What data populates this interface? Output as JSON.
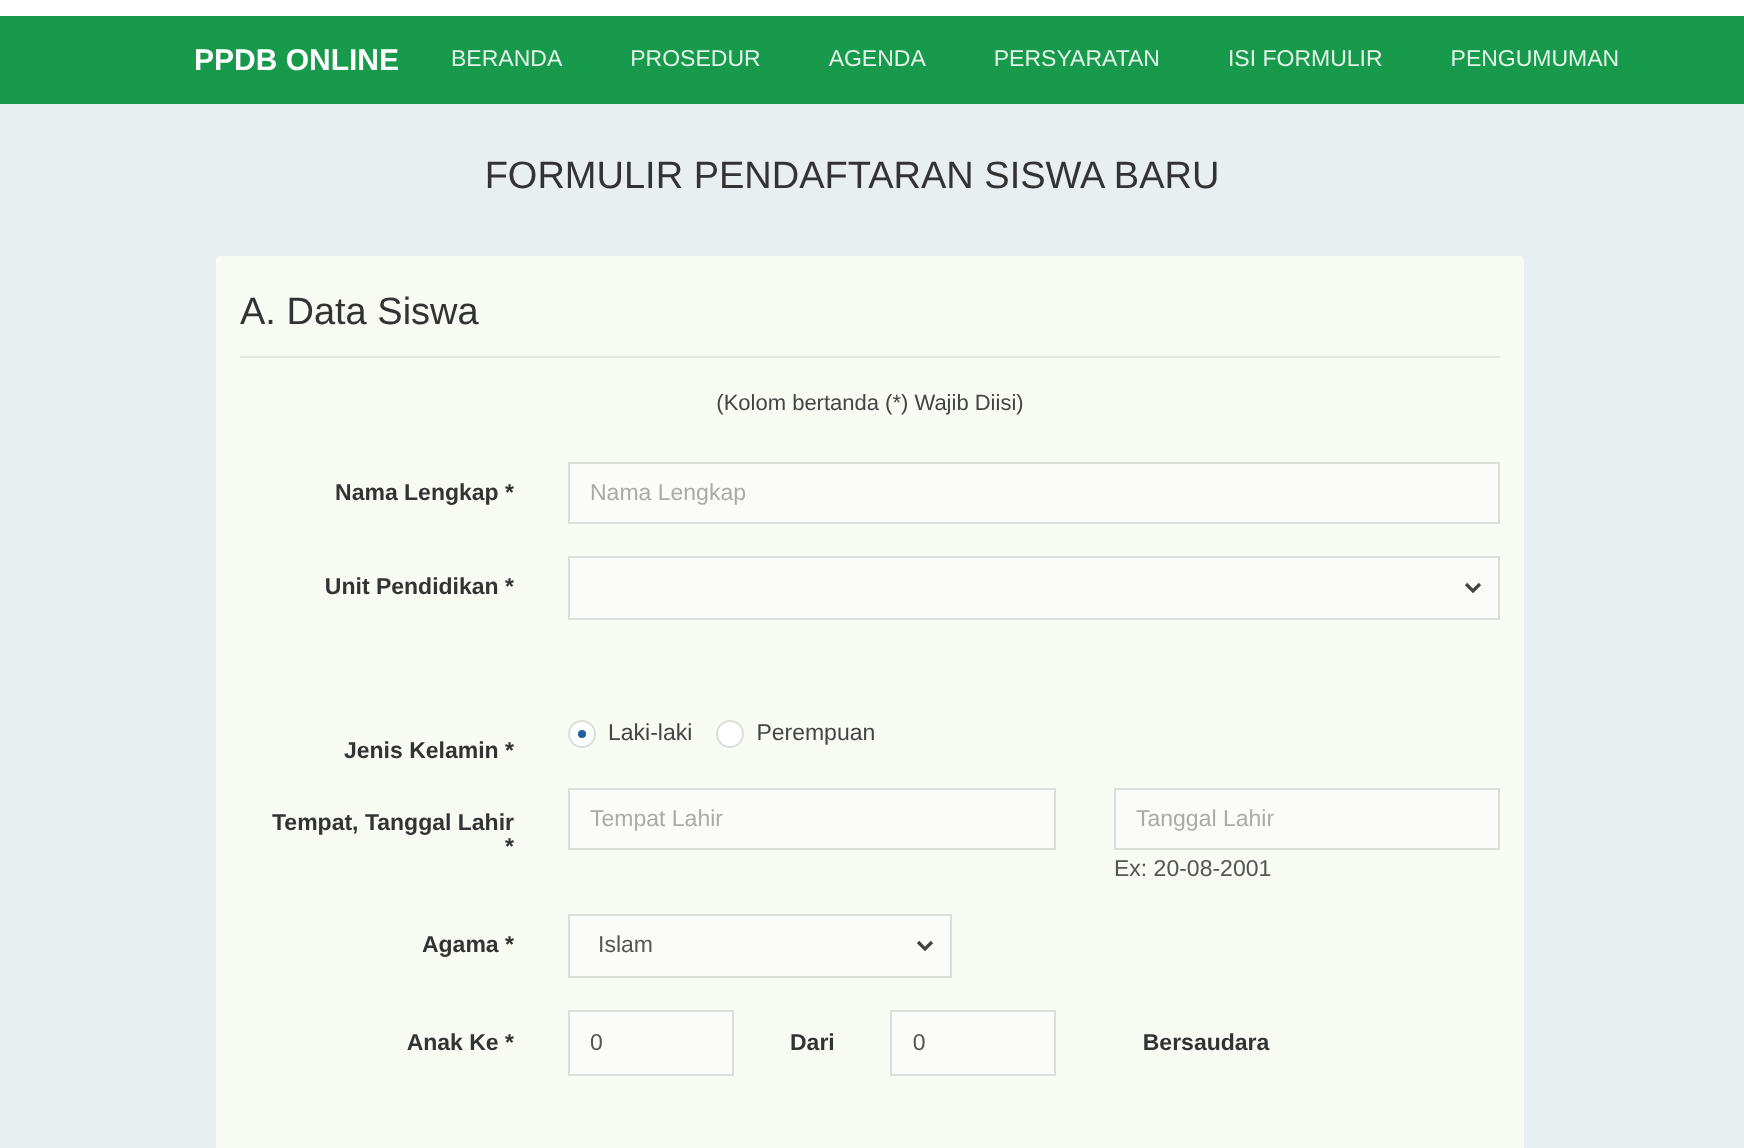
{
  "nav": {
    "brand": "PPDB ONLINE",
    "items": [
      {
        "label": "BERANDA"
      },
      {
        "label": "PROSEDUR"
      },
      {
        "label": "AGENDA"
      },
      {
        "label": "PERSYARATAN"
      },
      {
        "label": "ISI FORMULIR"
      },
      {
        "label": "PENGUMUMAN"
      }
    ]
  },
  "page_title": "FORMULIR PENDAFTARAN SISWA BARU",
  "section": {
    "title": "A. Data Siswa",
    "note": "(Kolom bertanda (*) Wajib Diisi)"
  },
  "fields": [
    {
      "kind": "text",
      "label": "Nama Lengkap *",
      "placeholder": "Nama Lengkap"
    },
    {
      "kind": "select",
      "label": "Unit Pendidikan *"
    },
    {
      "kind": "radio",
      "label": "Jenis Kelamin *",
      "options": [
        {
          "label": "Laki-laki",
          "selected": true
        },
        {
          "label": "Perempuan",
          "selected": false
        }
      ]
    },
    {
      "kind": "birth",
      "label": "Tempat, Tanggal Lahir *",
      "place_placeholder": "Tempat Lahir",
      "date_placeholder": "Tanggal Lahir",
      "date_hint": "Ex: 20-08-2001"
    },
    {
      "kind": "select_small",
      "label": "Agama *",
      "value": "Islam"
    },
    {
      "kind": "siblings",
      "label": "Anak Ke *",
      "value": "0",
      "of_label": "Dari",
      "of_value": "0",
      "suffix": "Bersaudara"
    }
  ]
}
